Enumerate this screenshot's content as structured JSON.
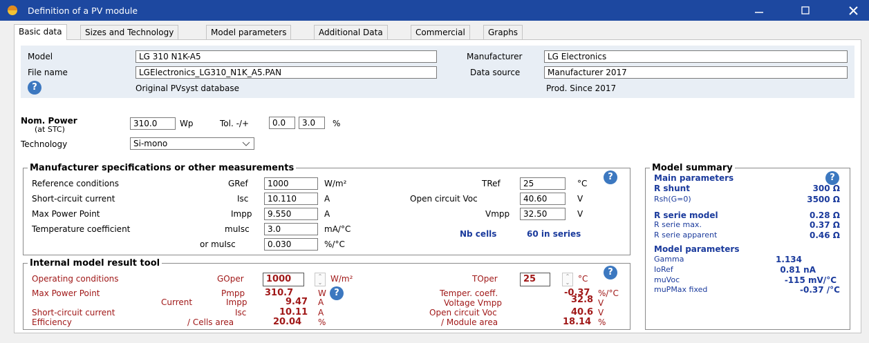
{
  "window": {
    "title": "Definition of a PV module"
  },
  "tabs": [
    {
      "label": "Basic data"
    },
    {
      "label": "Sizes and Technology"
    },
    {
      "label": "Model parameters"
    },
    {
      "label": "Additional Data"
    },
    {
      "label": "Commercial"
    },
    {
      "label": "Graphs"
    }
  ],
  "header": {
    "model_label": "Model",
    "model_value": "LG 310 N1K-A5",
    "filename_label": "File name",
    "filename_value": "LGElectronics_LG310_N1K_A5.PAN",
    "database_text": "Original PVsyst database",
    "manufacturer_label": "Manufacturer",
    "manufacturer_value": "LG Electronics",
    "datasource_label": "Data source",
    "datasource_value": "Manufacturer 2017",
    "prod_since": "Prod. Since 2017"
  },
  "nom": {
    "label": "Nom. Power",
    "sublabel": "(at STC)",
    "power_value": "310.0",
    "power_unit": "Wp",
    "tol_label": "Tol. -/+",
    "tol_minus": "0.0",
    "tol_plus": "3.0",
    "tol_unit": "%",
    "tech_label": "Technology",
    "tech_value": "Si-mono"
  },
  "spec": {
    "legend": "Manufacturer specifications or other measurements",
    "ref_label": "Reference conditions",
    "gref_label": "GRef",
    "gref_value": "1000",
    "gref_unit": "W/m²",
    "tref_label": "TRef",
    "tref_value": "25",
    "tref_unit": "°C",
    "sc_label": "Short-circuit current",
    "isc_label": "Isc",
    "isc_value": "10.110",
    "isc_unit": "A",
    "voc_label": "Open circuit Voc",
    "voc_value": "40.60",
    "voc_unit": "V",
    "mpp_label": "Max Power Point",
    "impp_label": "Impp",
    "impp_value": "9.550",
    "impp_unit": "A",
    "vmpp_label": "Vmpp",
    "vmpp_value": "32.50",
    "vmpp_unit": "V",
    "tc_label": "Temperature coefficient",
    "muisc_label": "muIsc",
    "muisc_value": "3.0",
    "muisc_unit": "mA/°C",
    "or_label": "or  muIsc",
    "muisc2_value": "0.030",
    "muisc2_unit": "%/°C",
    "nbcells_label": "Nb cells",
    "nbcells_value": "60 in series"
  },
  "tool": {
    "legend": "Internal model result tool",
    "oper_label": "Operating conditions",
    "goper_label": "GOper",
    "goper_value": "1000",
    "goper_unit": "W/m²",
    "toper_label": "TOper",
    "toper_value": "25",
    "toper_unit": "°C",
    "mpp_label": "Max Power Point",
    "pmpp_label": "Pmpp",
    "pmpp_value": "310.7",
    "pmpp_unit": "W",
    "current_label": "Current",
    "impp_label": "Impp",
    "impp_value": "9.47",
    "impp_unit": "A",
    "tempcoef_label": "Temper. coeff.",
    "tempcoef_value": "-0.37",
    "tempcoef_unit": "%/°C",
    "vmpp_label": "Voltage Vmpp",
    "vmpp_value": "32.8",
    "vmpp_unit": "V",
    "sc_label": "Short-circuit current",
    "isc_label": "Isc",
    "isc_value": "10.11",
    "isc_unit": "A",
    "voc_label": "Open circuit Voc",
    "voc_value": "40.6",
    "voc_unit": "V",
    "eff_label": "Efficiency",
    "cells_label": "/ Cells area",
    "cells_value": "20.04",
    "cells_unit": "%",
    "module_label": "/ Module area",
    "module_value": "18.14",
    "module_unit": "%"
  },
  "summary": {
    "legend": "Model summary",
    "main_title": "Main parameters",
    "rshunt_label": "R shunt",
    "rshunt_value": "300 Ω",
    "rsh0_label": "Rsh(G=0)",
    "rsh0_value": "3500 Ω",
    "rserie_label": "R serie model",
    "rserie_value": "0.28 Ω",
    "rseriemax_label": "R serie max.",
    "rseriemax_value": "0.37 Ω",
    "rserieapp_label": "R serie apparent",
    "rserieapp_value": "0.46 Ω",
    "model_title": "Model parameters",
    "gamma_label": "Gamma",
    "gamma_value": "1.134",
    "ioref_label": "IoRef",
    "ioref_value": "0.81 nA",
    "muvoc_label": "muVoc",
    "muvoc_value": "-115 mV/°C",
    "mupmax_label": "muPMax fixed",
    "mupmax_value": "-0.37 /°C"
  },
  "colors": {
    "titlebar": "#1d48a0",
    "accent_red": "#a01818",
    "accent_blue": "#1a3a9c"
  }
}
